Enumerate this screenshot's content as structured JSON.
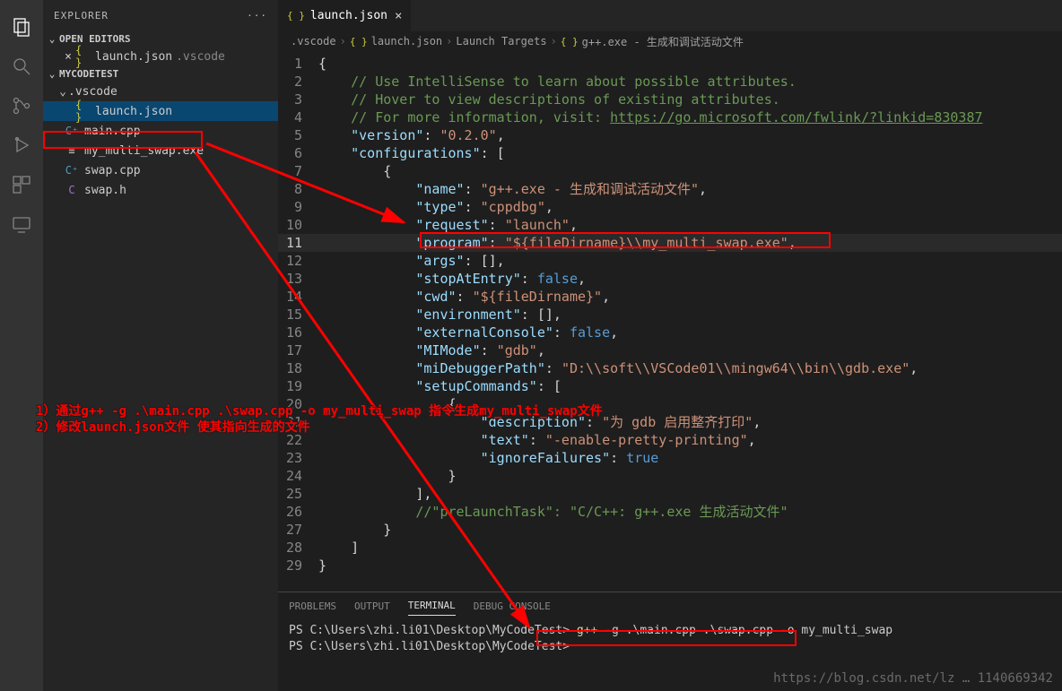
{
  "explorer": {
    "title": "EXPLORER",
    "open_editors_label": "OPEN EDITORS",
    "open_editors": [
      {
        "name": "launch.json",
        "dir": ".vscode",
        "icon": "json"
      }
    ],
    "root_label": "MYCODETEST",
    "folder_vscode_label": ".vscode",
    "files": {
      "launch_json": "launch.json",
      "main_cpp": "main.cpp",
      "exe": "my_multi_swap.exe",
      "swap_cpp": "swap.cpp",
      "swap_h": "swap.h"
    }
  },
  "tab": {
    "name": "launch.json",
    "close_glyph": "×"
  },
  "breadcrumbs": {
    "c0": ".vscode",
    "c1": "launch.json",
    "c2": "Launch Targets",
    "c3": "g++.exe - 生成和调试活动文件"
  },
  "code": {
    "lines": [
      {
        "n": 1,
        "seg": [
          {
            "c": "br",
            "t": "{"
          }
        ]
      },
      {
        "n": 2,
        "seg": [
          {
            "c": "cm",
            "t": "    // Use IntelliSense to learn about possible attributes."
          }
        ]
      },
      {
        "n": 3,
        "seg": [
          {
            "c": "cm",
            "t": "    // Hover to view descriptions of existing attributes."
          }
        ]
      },
      {
        "n": 4,
        "seg": [
          {
            "c": "cm",
            "t": "    // For more information, visit: "
          },
          {
            "c": "lnk",
            "t": "https://go.microsoft.com/fwlink/?linkid=830387"
          }
        ]
      },
      {
        "n": 5,
        "seg": [
          {
            "c": "br",
            "t": "    "
          },
          {
            "c": "key",
            "t": "\"version\""
          },
          {
            "c": "br",
            "t": ": "
          },
          {
            "c": "str",
            "t": "\"0.2.0\""
          },
          {
            "c": "br",
            "t": ","
          }
        ]
      },
      {
        "n": 6,
        "seg": [
          {
            "c": "br",
            "t": "    "
          },
          {
            "c": "key",
            "t": "\"configurations\""
          },
          {
            "c": "br",
            "t": ": ["
          }
        ]
      },
      {
        "n": 7,
        "seg": [
          {
            "c": "br",
            "t": "        {"
          }
        ]
      },
      {
        "n": 8,
        "seg": [
          {
            "c": "br",
            "t": "            "
          },
          {
            "c": "key",
            "t": "\"name\""
          },
          {
            "c": "br",
            "t": ": "
          },
          {
            "c": "str",
            "t": "\"g++.exe - 生成和调试活动文件\""
          },
          {
            "c": "br",
            "t": ","
          }
        ]
      },
      {
        "n": 9,
        "seg": [
          {
            "c": "br",
            "t": "            "
          },
          {
            "c": "key",
            "t": "\"type\""
          },
          {
            "c": "br",
            "t": ": "
          },
          {
            "c": "str",
            "t": "\"cppdbg\""
          },
          {
            "c": "br",
            "t": ","
          }
        ]
      },
      {
        "n": 10,
        "seg": [
          {
            "c": "br",
            "t": "            "
          },
          {
            "c": "key",
            "t": "\"request\""
          },
          {
            "c": "br",
            "t": ": "
          },
          {
            "c": "str",
            "t": "\"launch\""
          },
          {
            "c": "br",
            "t": ","
          }
        ]
      },
      {
        "n": 11,
        "hl": true,
        "seg": [
          {
            "c": "br",
            "t": "            "
          },
          {
            "c": "key",
            "t": "\"program\""
          },
          {
            "c": "br",
            "t": ": "
          },
          {
            "c": "str",
            "t": "\"${fileDirname}\\\\my_multi_swap.exe\""
          },
          {
            "c": "br",
            "t": ","
          }
        ]
      },
      {
        "n": 12,
        "seg": [
          {
            "c": "br",
            "t": "            "
          },
          {
            "c": "key",
            "t": "\"args\""
          },
          {
            "c": "br",
            "t": ": [],"
          }
        ]
      },
      {
        "n": 13,
        "seg": [
          {
            "c": "br",
            "t": "            "
          },
          {
            "c": "key",
            "t": "\"stopAtEntry\""
          },
          {
            "c": "br",
            "t": ": "
          },
          {
            "c": "bool",
            "t": "false"
          },
          {
            "c": "br",
            "t": ","
          }
        ]
      },
      {
        "n": 14,
        "seg": [
          {
            "c": "br",
            "t": "            "
          },
          {
            "c": "key",
            "t": "\"cwd\""
          },
          {
            "c": "br",
            "t": ": "
          },
          {
            "c": "str",
            "t": "\"${fileDirname}\""
          },
          {
            "c": "br",
            "t": ","
          }
        ]
      },
      {
        "n": 15,
        "seg": [
          {
            "c": "br",
            "t": "            "
          },
          {
            "c": "key",
            "t": "\"environment\""
          },
          {
            "c": "br",
            "t": ": [],"
          }
        ]
      },
      {
        "n": 16,
        "seg": [
          {
            "c": "br",
            "t": "            "
          },
          {
            "c": "key",
            "t": "\"externalConsole\""
          },
          {
            "c": "br",
            "t": ": "
          },
          {
            "c": "bool",
            "t": "false"
          },
          {
            "c": "br",
            "t": ","
          }
        ]
      },
      {
        "n": 17,
        "seg": [
          {
            "c": "br",
            "t": "            "
          },
          {
            "c": "key",
            "t": "\"MIMode\""
          },
          {
            "c": "br",
            "t": ": "
          },
          {
            "c": "str",
            "t": "\"gdb\""
          },
          {
            "c": "br",
            "t": ","
          }
        ]
      },
      {
        "n": 18,
        "seg": [
          {
            "c": "br",
            "t": "            "
          },
          {
            "c": "key",
            "t": "\"miDebuggerPath\""
          },
          {
            "c": "br",
            "t": ": "
          },
          {
            "c": "str",
            "t": "\"D:\\\\soft\\\\VSCode01\\\\mingw64\\\\bin\\\\gdb.exe\""
          },
          {
            "c": "br",
            "t": ","
          }
        ]
      },
      {
        "n": 19,
        "seg": [
          {
            "c": "br",
            "t": "            "
          },
          {
            "c": "key",
            "t": "\"setupCommands\""
          },
          {
            "c": "br",
            "t": ": ["
          }
        ]
      },
      {
        "n": 20,
        "seg": [
          {
            "c": "br",
            "t": "                {"
          }
        ]
      },
      {
        "n": 21,
        "seg": [
          {
            "c": "br",
            "t": "                    "
          },
          {
            "c": "key",
            "t": "\"description\""
          },
          {
            "c": "br",
            "t": ": "
          },
          {
            "c": "str",
            "t": "\"为 gdb 启用整齐打印\""
          },
          {
            "c": "br",
            "t": ","
          }
        ]
      },
      {
        "n": 22,
        "seg": [
          {
            "c": "br",
            "t": "                    "
          },
          {
            "c": "key",
            "t": "\"text\""
          },
          {
            "c": "br",
            "t": ": "
          },
          {
            "c": "str",
            "t": "\"-enable-pretty-printing\""
          },
          {
            "c": "br",
            "t": ","
          }
        ]
      },
      {
        "n": 23,
        "seg": [
          {
            "c": "br",
            "t": "                    "
          },
          {
            "c": "key",
            "t": "\"ignoreFailures\""
          },
          {
            "c": "br",
            "t": ": "
          },
          {
            "c": "bool",
            "t": "true"
          }
        ]
      },
      {
        "n": 24,
        "seg": [
          {
            "c": "br",
            "t": "                }"
          }
        ]
      },
      {
        "n": 25,
        "seg": [
          {
            "c": "br",
            "t": "            ],"
          }
        ]
      },
      {
        "n": 26,
        "seg": [
          {
            "c": "br",
            "t": "            "
          },
          {
            "c": "cm",
            "t": "//\"preLaunchTask\": \"C/C++: g++.exe 生成活动文件\""
          }
        ]
      },
      {
        "n": 27,
        "seg": [
          {
            "c": "br",
            "t": "        }"
          }
        ]
      },
      {
        "n": 28,
        "seg": [
          {
            "c": "br",
            "t": "    ]"
          }
        ]
      },
      {
        "n": 29,
        "seg": [
          {
            "c": "br",
            "t": "}"
          }
        ]
      }
    ]
  },
  "panel": {
    "tabs": {
      "problems": "PROBLEMS",
      "output": "OUTPUT",
      "terminal": "TERMINAL",
      "debug": "DEBUG CONSOLE"
    },
    "termLines": [
      {
        "prompt": "PS C:\\Users\\zhi.li01\\Desktop\\MyCodeTest> ",
        "cmd": "g++",
        "rest": " -g .\\main.cpp .\\swap.cpp -o my_multi_swap"
      },
      {
        "prompt": "PS C:\\Users\\zhi.li01\\Desktop\\MyCodeTest> ",
        "cmd": "",
        "rest": ""
      }
    ]
  },
  "annotations": {
    "line1": "1）通过g++ -g .\\main.cpp .\\swap.cpp -o my_multi_swap 指令生成my_multi_swap文件",
    "line2": "2）修改launch.json文件 使其指向生成的文件"
  },
  "watermark": "https://blog.csdn.net/lz … 1140669342"
}
